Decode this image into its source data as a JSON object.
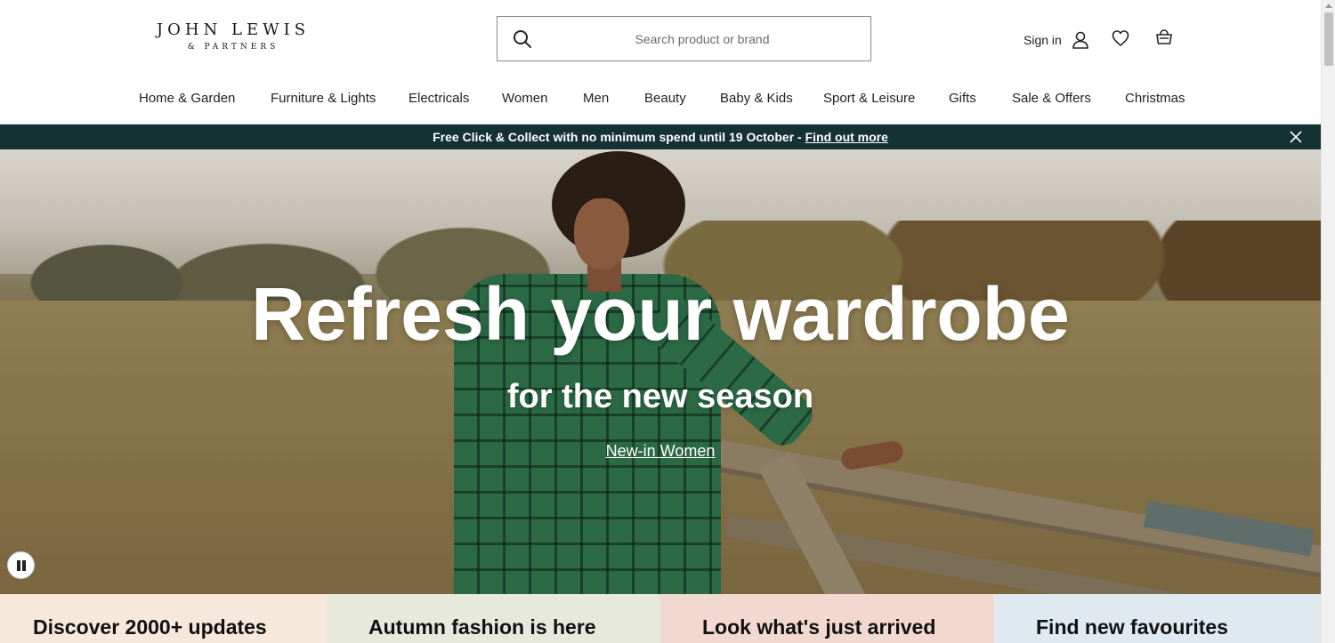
{
  "header": {
    "logo_main": "JOHN LEWIS",
    "logo_sub": "& PARTNERS",
    "search_placeholder": "Search product or brand",
    "sign_in": "Sign in"
  },
  "icons": {
    "search": "search-icon",
    "account": "user-icon",
    "wishlist": "heart-icon",
    "basket": "basket-icon",
    "close": "close-icon",
    "pause": "pause-icon"
  },
  "nav": {
    "items": [
      {
        "label": "Home & Garden"
      },
      {
        "label": "Furniture & Lights"
      },
      {
        "label": "Electricals"
      },
      {
        "label": "Women"
      },
      {
        "label": "Men"
      },
      {
        "label": "Beauty"
      },
      {
        "label": "Baby & Kids"
      },
      {
        "label": "Sport & Leisure"
      },
      {
        "label": "Gifts"
      },
      {
        "label": "Sale & Offers"
      },
      {
        "label": "Christmas"
      }
    ]
  },
  "promo": {
    "text": "Free Click & Collect with no minimum spend until 19 October - ",
    "link": "Find out more",
    "bg_color": "#143234"
  },
  "hero": {
    "title": "Refresh your wardrobe",
    "subtitle": "for the new season",
    "link": "New-in Women"
  },
  "cards": [
    {
      "title": "Discover 2000+ updates",
      "bg_color": "#f7e8dc"
    },
    {
      "title": "Autumn fashion is here",
      "bg_color": "#e7e9dd"
    },
    {
      "title": "Look what's just arrived",
      "bg_color": "#f1d9cf"
    },
    {
      "title": "Find new favourites",
      "bg_color": "#dfe9ef"
    }
  ]
}
